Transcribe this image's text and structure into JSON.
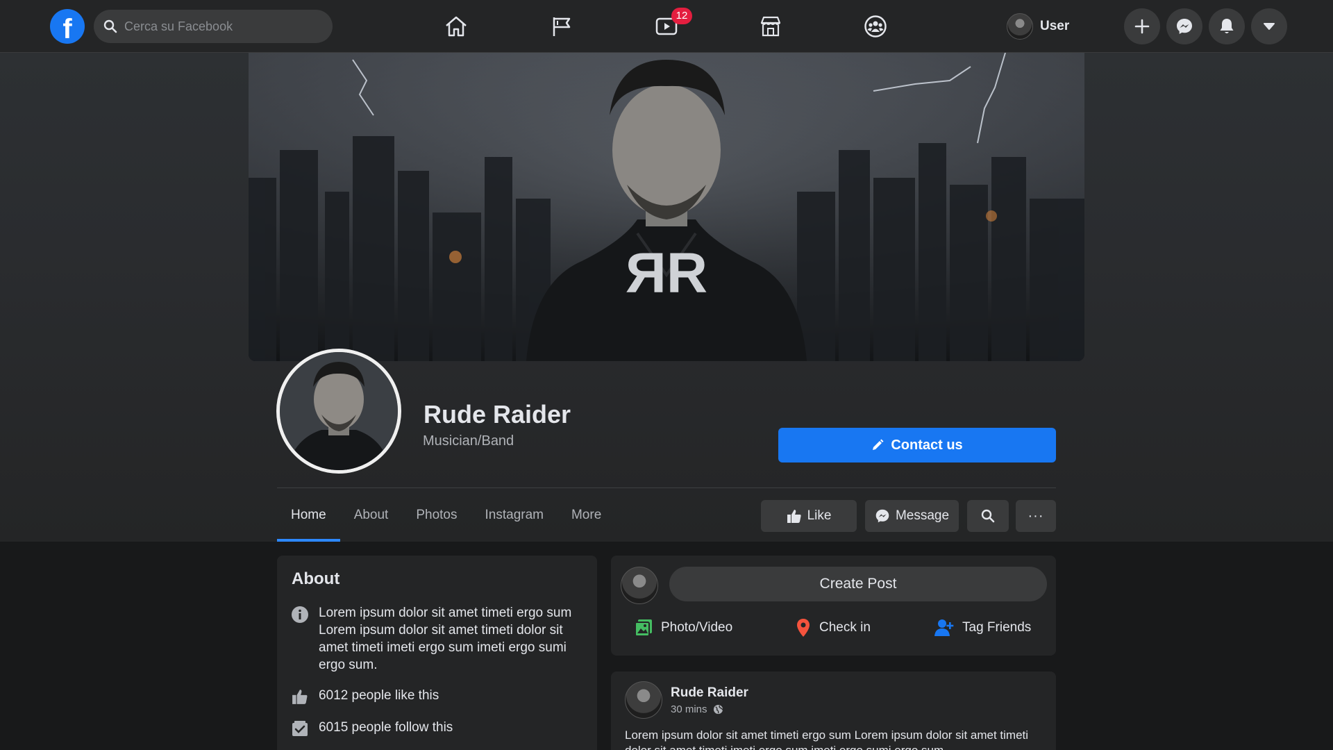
{
  "topbar": {
    "search_placeholder": "Cerca su Facebook",
    "video_badge": "12",
    "user_name": "User",
    "nav_icons": [
      "home-icon",
      "pages-flag-icon",
      "watch-icon",
      "marketplace-icon",
      "groups-icon"
    ],
    "action_icons": [
      "plus-icon",
      "messenger-icon",
      "bell-icon",
      "caret-down-icon"
    ]
  },
  "profile": {
    "name": "Rude Raider",
    "category": "Musician/Band",
    "contact_button": "Contact us",
    "logo_monogram": "ЯR"
  },
  "tabs": [
    {
      "label": "Home",
      "active": true
    },
    {
      "label": "About",
      "active": false
    },
    {
      "label": "Photos",
      "active": false
    },
    {
      "label": "Instagram",
      "active": false
    },
    {
      "label": "More",
      "active": false
    }
  ],
  "actions": {
    "like_label": "Like",
    "message_label": "Message",
    "more_label": "···"
  },
  "about": {
    "title": "About",
    "description": "Lorem ipsum dolor sit amet timeti ergo sum Lorem ipsum dolor sit amet timeti dolor sit amet timeti imeti ergo sum imeti ergo sumi ergo sum.",
    "likes": "6012 people like this",
    "follows": "6015 people follow this"
  },
  "composer": {
    "create_post": "Create Post",
    "photo_video": "Photo/Video",
    "check_in": "Check in",
    "tag_friends": "Tag Friends"
  },
  "post": {
    "author": "Rude Raider",
    "time": "30 mins",
    "text": "Lorem ipsum dolor sit amet timeti ergo sum Lorem ipsum dolor sit amet timeti dolor sit amet timeti imeti ergo sum imeti ergo sumi ergo sum."
  },
  "colors": {
    "accent": "#1877f2",
    "tab_underline": "#2d88ff",
    "badge": "#e41e3f",
    "background": "#18191a",
    "surface": "#242526"
  }
}
